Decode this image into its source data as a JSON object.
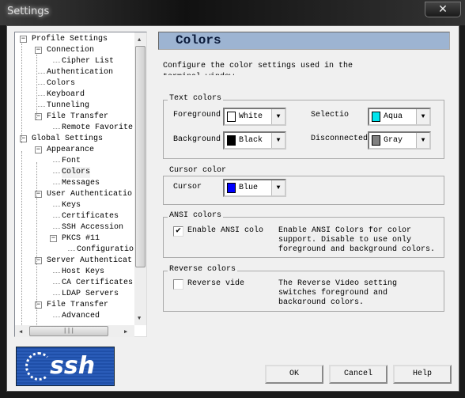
{
  "window": {
    "title": "Settings",
    "close_icon": "close-icon"
  },
  "tree": {
    "items": [
      {
        "label": "Profile Settings",
        "level": 0,
        "expandable": true
      },
      {
        "label": "Connection",
        "level": 1,
        "expandable": true
      },
      {
        "label": "Cipher List",
        "level": 2
      },
      {
        "label": "Authentication",
        "level": 1
      },
      {
        "label": "Colors",
        "level": 1
      },
      {
        "label": "Keyboard",
        "level": 1
      },
      {
        "label": "Tunneling",
        "level": 1
      },
      {
        "label": "File Transfer",
        "level": 1,
        "expandable": true
      },
      {
        "label": "Remote Favorite",
        "level": 2
      },
      {
        "label": "Global Settings",
        "level": 0,
        "expandable": true
      },
      {
        "label": "Appearance",
        "level": 1,
        "expandable": true
      },
      {
        "label": "Font",
        "level": 2
      },
      {
        "label": "Colors",
        "level": 2,
        "selected": true
      },
      {
        "label": "Messages",
        "level": 2
      },
      {
        "label": "User Authenticatio",
        "level": 1,
        "expandable": true
      },
      {
        "label": "Keys",
        "level": 2
      },
      {
        "label": "Certificates",
        "level": 2
      },
      {
        "label": "SSH Accession",
        "level": 2
      },
      {
        "label": "PKCS #11",
        "level": 2,
        "expandable": true
      },
      {
        "label": "Configuratio",
        "level": 3
      },
      {
        "label": "Server Authenticat",
        "level": 1,
        "expandable": true
      },
      {
        "label": "Host Keys",
        "level": 2
      },
      {
        "label": "CA Certificates",
        "level": 2
      },
      {
        "label": "LDAP Servers",
        "level": 2
      },
      {
        "label": "File Transfer",
        "level": 1,
        "expandable": true
      },
      {
        "label": "Advanced",
        "level": 2
      }
    ]
  },
  "logo": {
    "text": "ssh"
  },
  "panel": {
    "title": "Colors",
    "description": "Configure the color settings used in the terminal window.",
    "text_colors": {
      "legend": "Text colors",
      "foreground": {
        "label": "Foreground",
        "value": "White",
        "color": "#ffffff"
      },
      "background": {
        "label": "Background:",
        "value": "Black",
        "color": "#000000"
      },
      "selection": {
        "label": "Selectio",
        "value": "Aqua",
        "color": "#00e5ee"
      },
      "disconnected": {
        "label": "Disconnected",
        "value": "Gray",
        "color": "#808080"
      }
    },
    "cursor_color": {
      "legend": "Cursor color",
      "cursor": {
        "label": "Cursor",
        "value": "Blue",
        "color": "#0000ff"
      }
    },
    "ansi": {
      "legend": "ANSI colors",
      "checkbox_label": "Enable ANSI colo:",
      "checked": true,
      "help": "Enable ANSI Colors for color support. Disable to use only foreground and background colors."
    },
    "reverse": {
      "legend": "Reverse colors",
      "checkbox_label": "Reverse vide",
      "checked": false,
      "help": "The Reverse Video setting switches foreground and background colors."
    }
  },
  "buttons": {
    "ok": "OK",
    "cancel": "Cancel",
    "help": "Help"
  }
}
